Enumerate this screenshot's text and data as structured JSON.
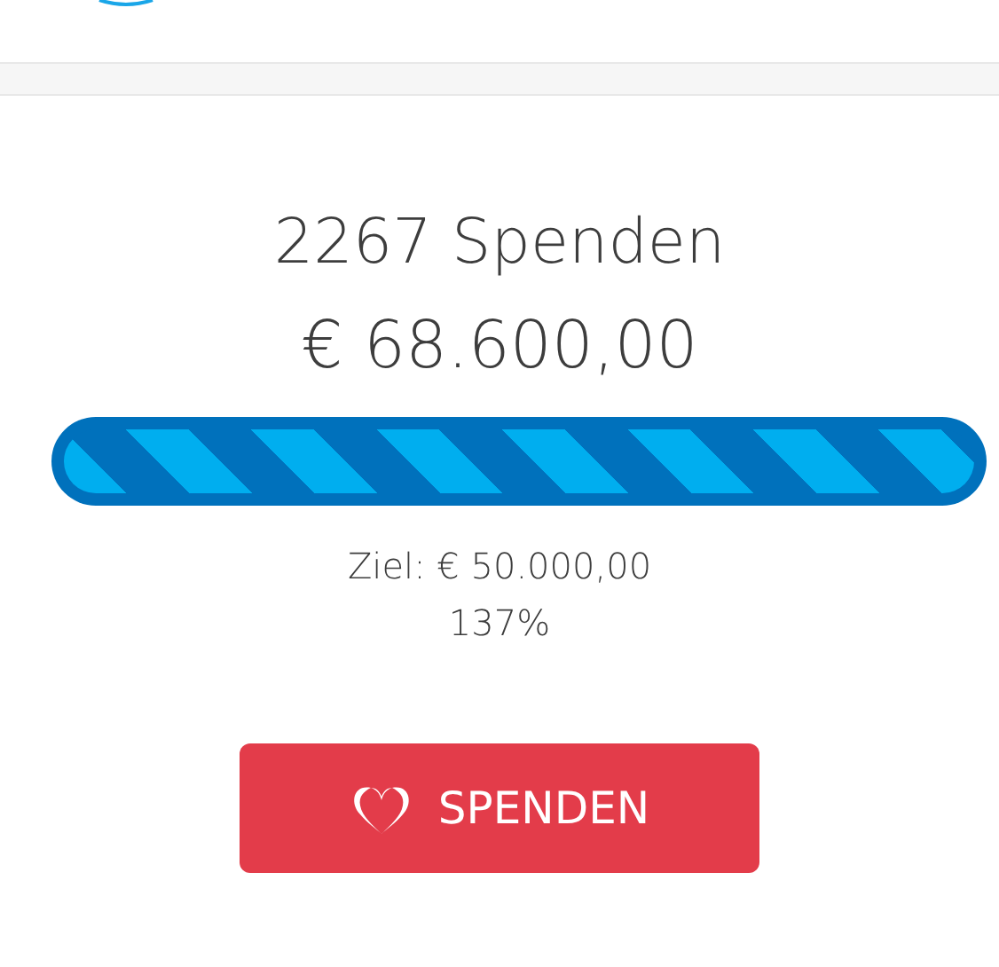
{
  "donations": "2267 Spenden",
  "amount": "€ 68.600,00",
  "progress": {
    "level": 1
  },
  "goal": "Ziel: € 50.000,00",
  "percent": "137%",
  "button": {
    "label": "SPENDEN"
  }
}
